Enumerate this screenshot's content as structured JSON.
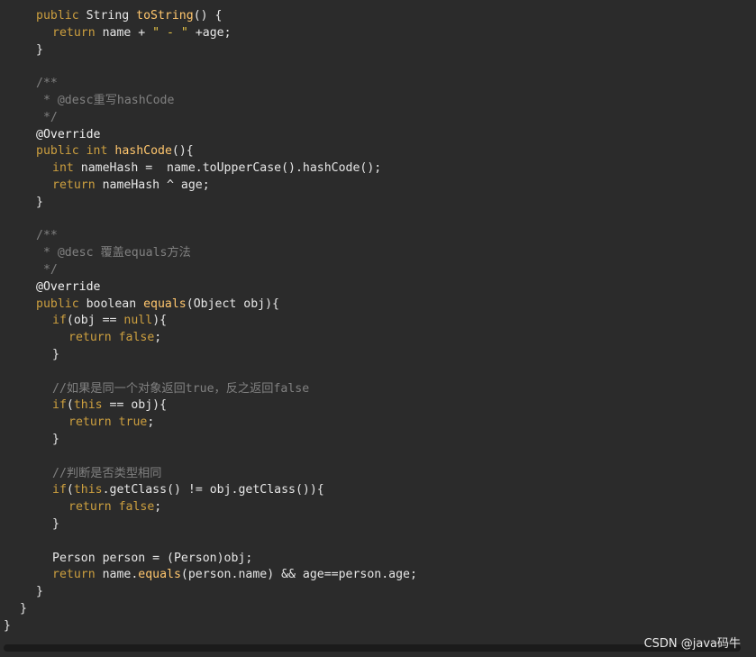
{
  "colors": {
    "background": "#2b2b2b",
    "keyword": "#cc9f3f",
    "function": "#ffc66d",
    "string": "#e7c547",
    "comment": "#808080",
    "text": "#e6e6e6"
  },
  "code": {
    "lines": [
      {
        "indent": 4,
        "tokens": [
          {
            "t": "public",
            "c": "kw"
          },
          {
            "t": " String ",
            "c": "id"
          },
          {
            "t": "toString",
            "c": "fn"
          },
          {
            "t": "() {",
            "c": "id"
          }
        ]
      },
      {
        "indent": 6,
        "tokens": [
          {
            "t": "return",
            "c": "kw"
          },
          {
            "t": " name + ",
            "c": "id"
          },
          {
            "t": "\" - \"",
            "c": "str"
          },
          {
            "t": " +age;",
            "c": "id"
          }
        ]
      },
      {
        "indent": 4,
        "tokens": [
          {
            "t": "}",
            "c": "id"
          }
        ]
      },
      {
        "indent": 0,
        "tokens": []
      },
      {
        "indent": 4,
        "tokens": [
          {
            "t": "/**",
            "c": "cm"
          }
        ]
      },
      {
        "indent": 4,
        "tokens": [
          {
            "t": " * @desc重写hashCode",
            "c": "cm"
          }
        ]
      },
      {
        "indent": 4,
        "tokens": [
          {
            "t": " */",
            "c": "cm"
          }
        ]
      },
      {
        "indent": 4,
        "tokens": [
          {
            "t": "@Override",
            "c": "ann"
          }
        ]
      },
      {
        "indent": 4,
        "tokens": [
          {
            "t": "public",
            "c": "kw"
          },
          {
            "t": " ",
            "c": "id"
          },
          {
            "t": "int",
            "c": "kw"
          },
          {
            "t": " ",
            "c": "id"
          },
          {
            "t": "hashCode",
            "c": "fn"
          },
          {
            "t": "(){",
            "c": "id"
          }
        ]
      },
      {
        "indent": 6,
        "tokens": [
          {
            "t": "int",
            "c": "kw"
          },
          {
            "t": " nameHash =  name.toUpperCase().hashCode();",
            "c": "id"
          }
        ]
      },
      {
        "indent": 6,
        "tokens": [
          {
            "t": "return",
            "c": "kw"
          },
          {
            "t": " nameHash ^ age;",
            "c": "id"
          }
        ]
      },
      {
        "indent": 4,
        "tokens": [
          {
            "t": "}",
            "c": "id"
          }
        ]
      },
      {
        "indent": 0,
        "tokens": []
      },
      {
        "indent": 4,
        "tokens": [
          {
            "t": "/**",
            "c": "cm"
          }
        ]
      },
      {
        "indent": 4,
        "tokens": [
          {
            "t": " * @desc 覆盖equals方法",
            "c": "cm"
          }
        ]
      },
      {
        "indent": 4,
        "tokens": [
          {
            "t": " */",
            "c": "cm"
          }
        ]
      },
      {
        "indent": 4,
        "tokens": [
          {
            "t": "@Override",
            "c": "ann"
          }
        ]
      },
      {
        "indent": 4,
        "tokens": [
          {
            "t": "public",
            "c": "kw"
          },
          {
            "t": " boolean ",
            "c": "id"
          },
          {
            "t": "equals",
            "c": "fn"
          },
          {
            "t": "(Object obj){",
            "c": "id"
          }
        ]
      },
      {
        "indent": 6,
        "tokens": [
          {
            "t": "if",
            "c": "kw"
          },
          {
            "t": "(obj == ",
            "c": "id"
          },
          {
            "t": "null",
            "c": "kw"
          },
          {
            "t": "){",
            "c": "id"
          }
        ]
      },
      {
        "indent": 8,
        "tokens": [
          {
            "t": "return",
            "c": "kw"
          },
          {
            "t": " ",
            "c": "id"
          },
          {
            "t": "false",
            "c": "kw"
          },
          {
            "t": ";",
            "c": "id"
          }
        ]
      },
      {
        "indent": 6,
        "tokens": [
          {
            "t": "}",
            "c": "id"
          }
        ]
      },
      {
        "indent": 0,
        "tokens": []
      },
      {
        "indent": 6,
        "tokens": [
          {
            "t": "//如果是同一个对象返回true，反之返回false",
            "c": "cm"
          }
        ]
      },
      {
        "indent": 6,
        "tokens": [
          {
            "t": "if",
            "c": "kw"
          },
          {
            "t": "(",
            "c": "id"
          },
          {
            "t": "this",
            "c": "kw"
          },
          {
            "t": " == obj){",
            "c": "id"
          }
        ]
      },
      {
        "indent": 8,
        "tokens": [
          {
            "t": "return",
            "c": "kw"
          },
          {
            "t": " ",
            "c": "id"
          },
          {
            "t": "true",
            "c": "kw"
          },
          {
            "t": ";",
            "c": "id"
          }
        ]
      },
      {
        "indent": 6,
        "tokens": [
          {
            "t": "}",
            "c": "id"
          }
        ]
      },
      {
        "indent": 0,
        "tokens": []
      },
      {
        "indent": 6,
        "tokens": [
          {
            "t": "//判断是否类型相同",
            "c": "cm"
          }
        ]
      },
      {
        "indent": 6,
        "tokens": [
          {
            "t": "if",
            "c": "kw"
          },
          {
            "t": "(",
            "c": "id"
          },
          {
            "t": "this",
            "c": "kw"
          },
          {
            "t": ".getClass() != obj.getClass()){",
            "c": "id"
          }
        ]
      },
      {
        "indent": 8,
        "tokens": [
          {
            "t": "return",
            "c": "kw"
          },
          {
            "t": " ",
            "c": "id"
          },
          {
            "t": "false",
            "c": "kw"
          },
          {
            "t": ";",
            "c": "id"
          }
        ]
      },
      {
        "indent": 6,
        "tokens": [
          {
            "t": "}",
            "c": "id"
          }
        ]
      },
      {
        "indent": 0,
        "tokens": []
      },
      {
        "indent": 6,
        "tokens": [
          {
            "t": "Person person = (Person)obj;",
            "c": "id"
          }
        ]
      },
      {
        "indent": 6,
        "tokens": [
          {
            "t": "return",
            "c": "kw"
          },
          {
            "t": " name.",
            "c": "id"
          },
          {
            "t": "equals",
            "c": "fn"
          },
          {
            "t": "(person.name) && age==person.age;",
            "c": "id"
          }
        ]
      },
      {
        "indent": 4,
        "tokens": [
          {
            "t": "}",
            "c": "id"
          }
        ]
      },
      {
        "indent": 2,
        "tokens": [
          {
            "t": "}",
            "c": "id"
          }
        ]
      },
      {
        "indent": 0,
        "tokens": [
          {
            "t": "}",
            "c": "id"
          }
        ]
      }
    ]
  },
  "watermark": {
    "text": "CSDN @java码牛"
  }
}
